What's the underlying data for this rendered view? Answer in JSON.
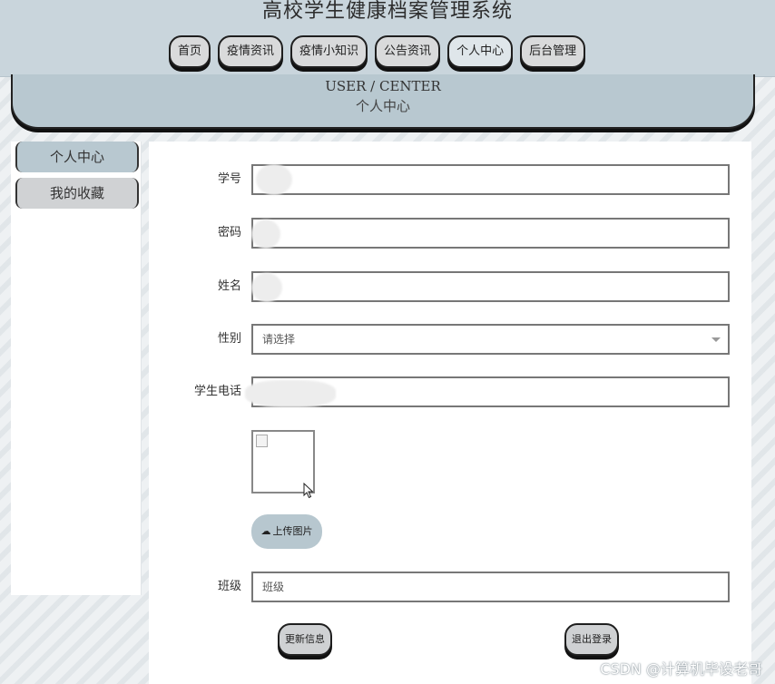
{
  "app": {
    "title": "高校学生健康档案管理系统"
  },
  "nav": {
    "items": [
      {
        "label": "首页"
      },
      {
        "label": "疫情资讯"
      },
      {
        "label": "疫情小知识"
      },
      {
        "label": "公告资讯"
      },
      {
        "label": "个人中心"
      },
      {
        "label": "后台管理"
      }
    ],
    "active": "个人中心"
  },
  "banner": {
    "en": "USER / CENTER",
    "cn": "个人中心"
  },
  "sidebar": {
    "items": [
      {
        "label": "个人中心"
      },
      {
        "label": "我的收藏"
      }
    ]
  },
  "form": {
    "student_id_label": "学号",
    "student_id_value": "",
    "password_label": "密码",
    "password_value": "",
    "name_label": "姓名",
    "name_value": "",
    "gender_label": "性别",
    "gender_placeholder": "请选择",
    "phone_label": "学生电话",
    "phone_value": "",
    "upload_label": "上传图片",
    "class_label": "班级",
    "class_placeholder": "班级",
    "update_label": "更新信息",
    "logout_label": "退出登录"
  },
  "watermark": "CSDN @计算机毕设老哥",
  "colors": {
    "header_bg": "#c9d5dc",
    "accent": "#b8c8d0",
    "button_bg": "#d9dadb",
    "border_dark": "#1f1f1f"
  }
}
